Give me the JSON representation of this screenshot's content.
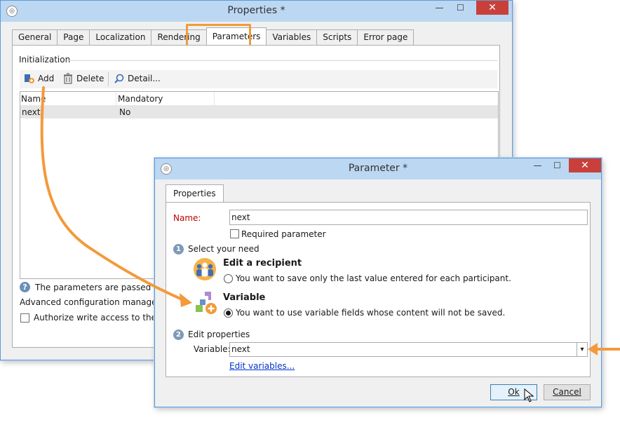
{
  "properties_window": {
    "title": "Properties *",
    "tabs": [
      "General",
      "Page",
      "Localization",
      "Rendering",
      "Parameters",
      "Variables",
      "Scripts",
      "Error page"
    ],
    "active_tab": "Parameters",
    "group_label": "Initialization",
    "toolbar": {
      "add": "Add",
      "delete": "Delete",
      "detail": "Detail..."
    },
    "columns": [
      "Name",
      "Mandatory"
    ],
    "rows": [
      {
        "name": "next",
        "mandatory": "No"
      }
    ],
    "help_text": "The parameters are passed in the",
    "advanced_text": "Advanced configuration management",
    "authorize_label": "Authorize write access to the cont"
  },
  "parameter_dialog": {
    "title": "Parameter *",
    "tab": "Properties",
    "name_label": "Name:",
    "name_value": "next",
    "required_label": "Required parameter",
    "step1": {
      "number": "1",
      "label": "Select your need"
    },
    "option_recipient": {
      "title": "Edit a recipient",
      "desc": "You want to save only the last value entered for each participant."
    },
    "option_variable": {
      "title": "Variable",
      "desc": "You want to use variable fields whose content will not be saved."
    },
    "step2": {
      "number": "2",
      "label": "Edit properties"
    },
    "variable_label": "Variable:",
    "variable_value": "next",
    "edit_variables_link": "Edit variables...",
    "ok_label": "Ok",
    "cancel_label": "Cancel"
  },
  "colors": {
    "highlight": "#f39a3b",
    "titlebar": "#bcd7f2",
    "close": "#c9403a",
    "required_label": "#c00000"
  }
}
